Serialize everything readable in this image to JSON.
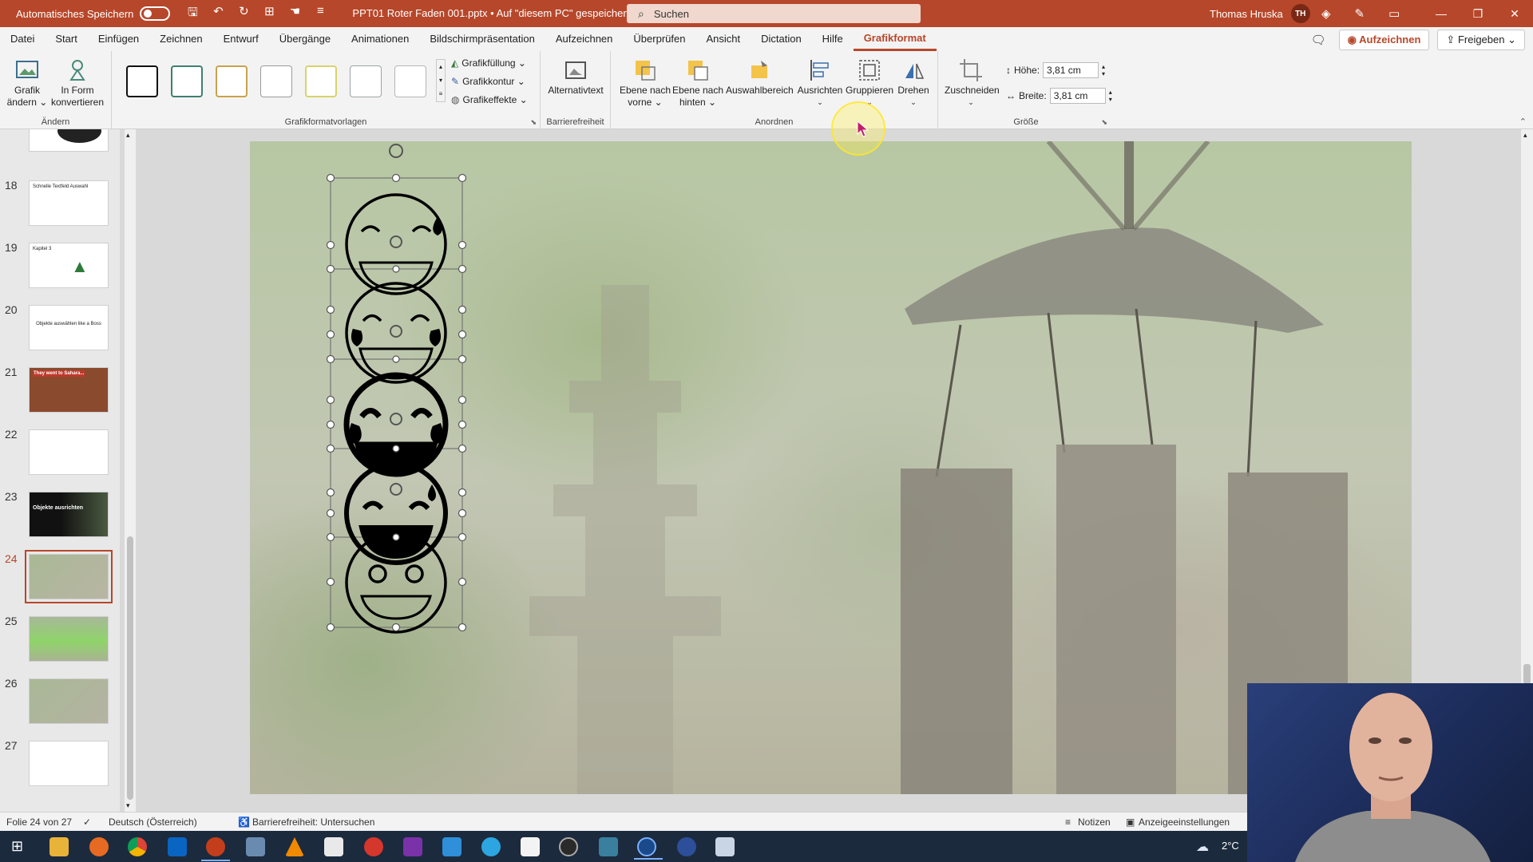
{
  "titlebar": {
    "autosave_label": "Automatisches Speichern",
    "doc_title": "PPT01 Roter Faden 001.pptx  •  Auf \"diesem PC\" gespeichert  ⌄",
    "search_placeholder": "Suchen",
    "user_name": "Thomas Hruska",
    "user_initials": "TH",
    "accent": "#b7472a"
  },
  "tabs": [
    "Datei",
    "Start",
    "Einfügen",
    "Zeichnen",
    "Entwurf",
    "Übergänge",
    "Animationen",
    "Bildschirmpräsentation",
    "Aufzeichnen",
    "Überprüfen",
    "Ansicht",
    "Dictation",
    "Hilfe",
    "Grafikformat"
  ],
  "tabs_right": {
    "record": "Aufzeichnen",
    "share": "Freigeben"
  },
  "ribbon": {
    "aendern": {
      "label": "Ändern",
      "grafik_aendern": "Grafik ändern ⌄",
      "in_form": "In Form konvertieren"
    },
    "vorlagen": {
      "label": "Grafikformatvorlagen",
      "fill": "Grafikfüllung ⌄",
      "outline": "Grafikkontur ⌄",
      "effects": "Grafikeffekte ⌄"
    },
    "barriere": {
      "label": "Barrierefreiheit",
      "alt": "Alternativtext"
    },
    "anordnen": {
      "label": "Anordnen",
      "forward": "Ebene nach vorne ⌄",
      "backward": "Ebene nach hinten ⌄",
      "selection": "Auswahlbereich",
      "align": "Ausrichten",
      "group": "Gruppieren",
      "rotate": "Drehen"
    },
    "groesse": {
      "label": "Größe",
      "crop": "Zuschneiden",
      "height_label": "Höhe:",
      "height": "3,81 cm",
      "width_label": "Breite:",
      "width": "3,81 cm"
    }
  },
  "slides": [
    {
      "num": "18",
      "text": "Schnelle Textfeld Auswahl"
    },
    {
      "num": "19",
      "text": "Kapitel 3"
    },
    {
      "num": "20",
      "text": "Objekte auswählen like a Boss"
    },
    {
      "num": "21",
      "text": "They went to Sahara..."
    },
    {
      "num": "22",
      "text": ""
    },
    {
      "num": "23",
      "text": "Objekte ausrichten"
    },
    {
      "num": "24",
      "text": ""
    },
    {
      "num": "25",
      "text": ""
    },
    {
      "num": "26",
      "text": ""
    },
    {
      "num": "27",
      "text": ""
    }
  ],
  "status": {
    "slide_info": "Folie 24 von 27",
    "language": "Deutsch (Österreich)",
    "accessibility": "Barrierefreiheit: Untersuchen",
    "notes": "Notizen",
    "display": "Anzeigeeinstellungen"
  },
  "taskbar": {
    "temperature": "2°C"
  }
}
